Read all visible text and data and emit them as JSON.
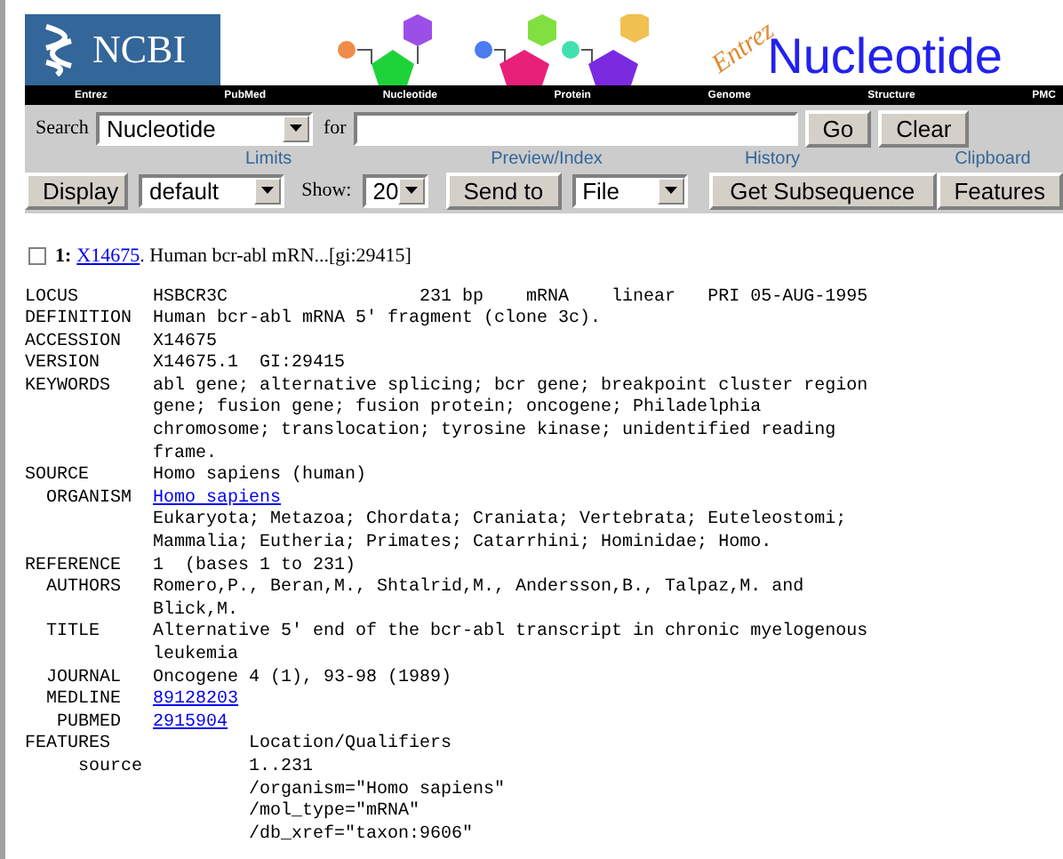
{
  "banner": {
    "logo": "NCBI",
    "subtitle": "Entrez",
    "title": "Nucleotide"
  },
  "nav": [
    "Entrez",
    "PubMed",
    "Nucleotide",
    "Protein",
    "Genome",
    "Structure",
    "PMC"
  ],
  "search": {
    "label": "Search",
    "database": "Nucleotide",
    "for_label": "for",
    "buttons": [
      "Go",
      "Clear"
    ]
  },
  "toolbar": {
    "section_labels": [
      "Limits",
      "Preview/Index",
      "History",
      "Clipboard"
    ],
    "display_button": "Display",
    "format": "default",
    "show_label": "Show:",
    "show_count": "20",
    "send_button": "Send to",
    "send_target": "File",
    "subsequence_button": "Get Subsequence",
    "features_button": "Features"
  },
  "record": {
    "checked": false,
    "number": "1:",
    "accession_link": "X14675",
    "summary": ". Human bcr-abl mRN...[gi:29415]",
    "lines": [
      {
        "text": "LOCUS       HSBCR3C                  231 bp    mRNA    linear   PRI 05-AUG-1995"
      },
      {
        "text": "DEFINITION  Human bcr-abl mRNA 5' fragment (clone 3c)."
      },
      {
        "text": "ACCESSION   X14675"
      },
      {
        "text": "VERSION     X14675.1  GI:29415"
      },
      {
        "text": "KEYWORDS    abl gene; alternative splicing; bcr gene; breakpoint cluster region"
      },
      {
        "text": "            gene; fusion gene; fusion protein; oncogene; Philadelphia"
      },
      {
        "text": "            chromosome; translocation; tyrosine kinase; unidentified reading"
      },
      {
        "text": "            frame."
      },
      {
        "text": "SOURCE      Homo sapiens (human)"
      },
      {
        "text": "  ORGANISM  ",
        "link": "Homo sapiens"
      },
      {
        "text": "            Eukaryota; Metazoa; Chordata; Craniata; Vertebrata; Euteleostomi;"
      },
      {
        "text": "            Mammalia; Eutheria; Primates; Catarrhini; Hominidae; Homo."
      },
      {
        "text": "REFERENCE   1  (bases 1 to 231)"
      },
      {
        "text": "  AUTHORS   Romero,P., Beran,M., Shtalrid,M., Andersson,B., Talpaz,M. and"
      },
      {
        "text": "            Blick,M."
      },
      {
        "text": "  TITLE     Alternative 5' end of the bcr-abl transcript in chronic myelogenous"
      },
      {
        "text": "            leukemia"
      },
      {
        "text": "  JOURNAL   Oncogene 4 (1), 93-98 (1989)"
      },
      {
        "text": "  MEDLINE   ",
        "link": "89128203"
      },
      {
        "text": "   PUBMED   ",
        "link": "2915904"
      },
      {
        "text": "FEATURES             Location/Qualifiers"
      },
      {
        "text": "     source          1..231"
      },
      {
        "text": "                     /organism=\"Homo sapiens\""
      },
      {
        "text": "                     /mol_type=\"mRNA\""
      },
      {
        "text": "                     /db_xref=\"taxon:9606\""
      }
    ]
  }
}
